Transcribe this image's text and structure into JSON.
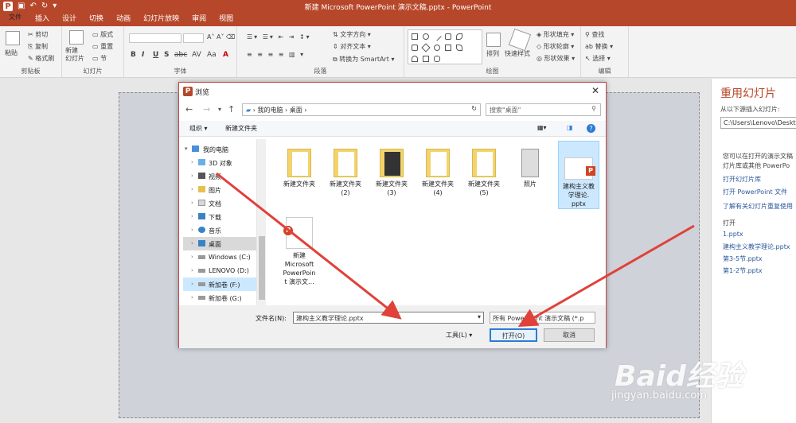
{
  "app": {
    "title": "新建 Microsoft PowerPoint 演示文稿.pptx - PowerPoint",
    "logo": "P"
  },
  "ribbon_tabs": [
    "文件",
    "开始",
    "插入",
    "设计",
    "切换",
    "动画",
    "幻灯片放映",
    "审阅",
    "视图"
  ],
  "ribbon": {
    "clipboard": {
      "paste": "粘贴",
      "cut": "剪切",
      "copy": "复制",
      "format_painter": "格式刷",
      "label": "剪贴板"
    },
    "slides": {
      "new_slide": "新建\n幻灯片",
      "layout": "版式",
      "reset": "重置",
      "section": "节",
      "label": "幻灯片"
    },
    "font": {
      "label": "字体",
      "format": [
        "B",
        "I",
        "U",
        "S",
        "abc",
        "AV",
        "Aa",
        "A"
      ]
    },
    "paragraph": {
      "text_direction": "文字方向",
      "align_text": "对齐文本",
      "smartart": "转换为 SmartArt",
      "label": "段落"
    },
    "drawing": {
      "arrange": "排列",
      "quick_styles": "快速样式",
      "fill": "形状填充",
      "outline": "形状轮廓",
      "effects": "形状效果",
      "label": "绘图"
    },
    "editing": {
      "find": "查找",
      "replace": "替换",
      "select": "选择",
      "label": "编辑"
    }
  },
  "pane": {
    "title": "重用幻灯片",
    "insert_from": "从以下源插入幻灯片:",
    "path": "C:\\Users\\Lenovo\\Deskt",
    "desc1": "您可以在打开的演示文稿",
    "desc2": "灯片库或其他 PowerPo",
    "open_library": "打开幻灯片库",
    "open_file": "打开 PowerPoint 文件",
    "learn_more": "了解有关幻灯片重复使用",
    "open_label": "打开",
    "recent": [
      "1.pptx",
      "建构主义教学理论.pptx",
      "第3-5节.pptx",
      "第1-2节.pptx"
    ]
  },
  "dialog": {
    "title": "浏览",
    "breadcrumb": [
      "我的电脑",
      "桌面"
    ],
    "search_placeholder": "搜索\"桌面\"",
    "organize": "组织 ▾",
    "new_folder": "新建文件夹",
    "tree": [
      {
        "label": "我的电脑",
        "icon": "computer-icon",
        "expanded": true
      },
      {
        "label": "3D 对象",
        "icon": "3d-objects-icon"
      },
      {
        "label": "视频",
        "icon": "video-icon"
      },
      {
        "label": "图片",
        "icon": "pictures-icon"
      },
      {
        "label": "文档",
        "icon": "documents-icon"
      },
      {
        "label": "下载",
        "icon": "downloads-icon"
      },
      {
        "label": "音乐",
        "icon": "music-icon"
      },
      {
        "label": "桌面",
        "icon": "desktop-icon",
        "selected": true
      },
      {
        "label": "Windows (C:)",
        "icon": "drive-icon"
      },
      {
        "label": "LENOVO (D:)",
        "icon": "drive-icon"
      },
      {
        "label": "新加卷 (F:)",
        "icon": "drive-icon",
        "highlight": true
      },
      {
        "label": "新加卷 (G:)",
        "icon": "drive-icon"
      }
    ],
    "files": [
      {
        "name": "新建文件夹",
        "type": "folder"
      },
      {
        "name": "新建文件夹\n(2)",
        "type": "folder"
      },
      {
        "name": "新建文件夹\n(3)",
        "type": "folder"
      },
      {
        "name": "新建文件夹\n(4)",
        "type": "folder"
      },
      {
        "name": "新建文件夹\n(5)",
        "type": "folder"
      },
      {
        "name": "照片",
        "type": "photo"
      },
      {
        "name": "建构主义教\n学理论.\npptx",
        "type": "pptx",
        "selected": true
      },
      {
        "name": "新建\nMicrosoft\nPowerPoin\nt 演示文...",
        "type": "pptx-doc"
      }
    ],
    "filename_label": "文件名(N):",
    "filename_value": "建构主义教学理论.pptx",
    "filetype_value": "所有 PowerPoint 演示文稿 (*.p",
    "tools": "工具(L)",
    "open": "打开(O)",
    "cancel": "取消"
  },
  "watermark": {
    "brand": "Baid经验",
    "url": "jingyan.baidu.com"
  },
  "colors": {
    "accent": "#b7472a",
    "arrow": "#e0413a",
    "link": "#2b579a",
    "selection": "#cce8ff"
  }
}
